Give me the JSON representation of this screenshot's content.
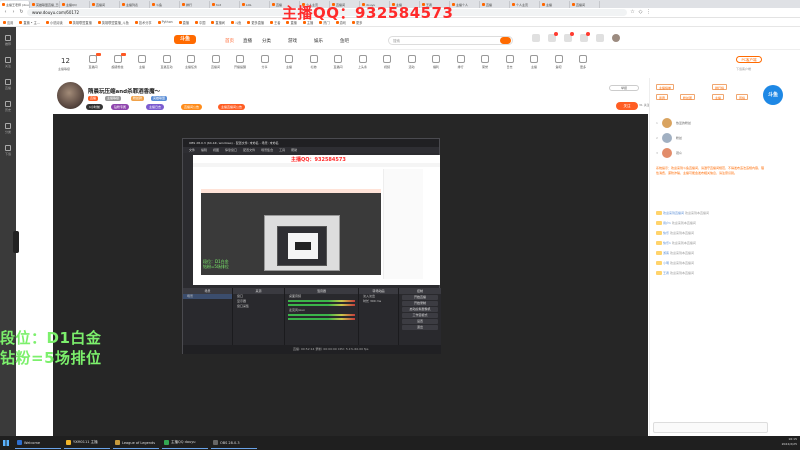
{
  "browser": {
    "tabs": [
      {
        "label": "主播王老师 (douyu)"
      },
      {
        "label": "英雄联盟直播_王者"
      },
      {
        "label": "主播QQ"
      },
      {
        "label": "直播间"
      },
      {
        "label": "主播列表"
      },
      {
        "label": "斗鱼"
      },
      {
        "label": "排行"
      },
      {
        "label": "hot"
      },
      {
        "label": "LOL"
      },
      {
        "label": "直播"
      },
      {
        "label": "个人主页"
      },
      {
        "label": "直播间"
      },
      {
        "label": "douyu"
      },
      {
        "label": "主播"
      },
      {
        "label": "王者"
      },
      {
        "label": "主播个人"
      },
      {
        "label": "直播"
      },
      {
        "label": "个人主页"
      },
      {
        "label": "主播"
      },
      {
        "label": "直播间"
      }
    ],
    "url": "www.douyu.com/60172",
    "bookmarks": [
      "应用",
      "直播 • 主...",
      "小说阅读",
      "英雄联盟直播",
      "英雄联盟直播_斗鱼",
      "技术分享",
      "Python",
      "直播",
      "中国",
      "直播间",
      "斗鱼",
      "更多直播",
      "王者",
      "直播",
      "主播",
      "热门",
      "游戏",
      "更多"
    ]
  },
  "overlay": {
    "streamer_qq": "主播QQ：932584573",
    "rank_line1": "段位：D1白金",
    "rank_line2": "钻粉=5场排位"
  },
  "sidebar": {
    "items": [
      "推荐",
      "关注",
      "直播",
      "历史",
      "分类",
      "下载"
    ]
  },
  "header": {
    "logo": "斗鱼",
    "nav": [
      "首页",
      "直播",
      "分类",
      "游戏",
      "娱乐"
    ],
    "search_placeholder": "搜索"
  },
  "toolbar": {
    "level": "12",
    "level_label": "主播等级",
    "items": [
      "直播间",
      "超级粉丝",
      "主播",
      "直播互动",
      "主播任务",
      "直播间",
      "开播提醒",
      "分享",
      "主播",
      "礼物",
      "直播间",
      "上头条",
      "视频",
      "活动",
      "福利",
      "排行",
      "荣誉",
      "日志",
      "主播",
      "鱼吧",
      "更多"
    ],
    "pc_button": "PC客户端",
    "pc_sub": "下载客户端"
  },
  "room": {
    "title": "隋晨玩压缩and杀罪酒香魔～",
    "tags": [
      "直播",
      "主播等级",
      "粉丝牌",
      "英雄联盟"
    ],
    "pills": [
      "1小时前",
      "钻粉专属",
      "主播日志",
      "直播间公告",
      "主播直播间公告"
    ],
    "report": "举报",
    "follow": "关注",
    "follow_count": "31 关注"
  },
  "obs": {
    "title": "OBS 28.0.3 (64-bit, windows) - 配置文件: 未命名 - 场景: 未命名",
    "menu": [
      "文件",
      "编辑",
      "视图",
      "停靠窗口",
      "配置文件",
      "场景集合",
      "工具",
      "帮助"
    ],
    "inner_qq": "主播QQ：932584573",
    "inner_rank1": "段位：D1白金",
    "inner_rank2": "钻粉=5场排位",
    "docks": {
      "scenes": {
        "header": "场景",
        "items": [
          "场景"
        ]
      },
      "sources": {
        "header": "来源",
        "items": [
          "窗口",
          "显示器",
          "窗口采集"
        ]
      },
      "mixer": {
        "header": "混音器",
        "items": [
          "桌面音频",
          "麦克风/Aux"
        ]
      },
      "transitions": {
        "header": "转场动画",
        "items": [
          "淡入淡出",
          "时长 300 ms"
        ]
      },
      "controls": {
        "header": "控制",
        "items": [
          "开始直播",
          "开始录制",
          "启动虚拟摄像机",
          "工作室模式",
          "设置",
          "退出"
        ]
      }
    },
    "status": "直播: 00:52:14   录制: 00:00:00   CPU: 5.1%   60.00 fps"
  },
  "chat": {
    "tabs": [
      "主播榜单",
      "排行榜",
      "贵宾",
      "粉丝团",
      "主播",
      "周榜"
    ],
    "ranks": [
      {
        "rank": "1",
        "name": "热爱的粉丝"
      },
      {
        "rank": "2",
        "name": "粉丝"
      },
      {
        "rank": "3",
        "name": "观众"
      }
    ],
    "welcome": "系统提示：欢迎来到斗鱼直播间，请遵守直播间规范，不得发布违法违规内容，理性消费，谨防诈骗，主播可能会发布相关信息，请注意识别。",
    "messages": [
      {
        "name": "欢迎来到直播间",
        "text": "欢迎来到本直播间"
      },
      {
        "name": "用户1",
        "text": "欢迎来到本直播间"
      },
      {
        "name": "快乐",
        "text": "欢迎来到本直播间"
      },
      {
        "name": "快乐1",
        "text": "欢迎来到本直播间"
      },
      {
        "name": "游客",
        "text": "欢迎来到本直播间"
      },
      {
        "name": "小明",
        "text": "欢迎来到本直播间"
      },
      {
        "name": "王者",
        "text": "欢迎来到本直播间"
      }
    ],
    "right_logo": "斗鱼"
  },
  "taskbar": {
    "items": [
      {
        "label": "Welcome",
        "color": "#2d6fd1"
      },
      {
        "label": "YXM0111 主播",
        "color": "#f0b429"
      },
      {
        "label": "League of Legends",
        "color": "#c89b3c"
      },
      {
        "label": "主播QQ douyu",
        "color": "#33a852"
      },
      {
        "label": "OBS 28.0.3",
        "color": "#666666"
      }
    ],
    "time": "16:15",
    "date": "2022/2/25"
  },
  "colors": {
    "accent": "#ff6a00",
    "qq_red": "#ff2a2a",
    "rank_green": "#7cf06c"
  }
}
